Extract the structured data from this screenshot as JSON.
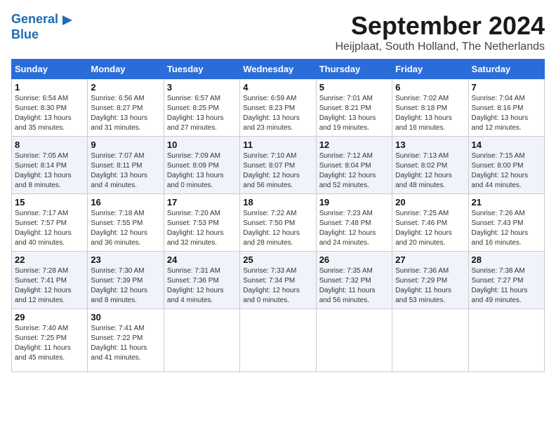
{
  "header": {
    "logo_line1": "General",
    "logo_line2": "Blue",
    "month_title": "September 2024",
    "location": "Heijplaat, South Holland, The Netherlands"
  },
  "weekdays": [
    "Sunday",
    "Monday",
    "Tuesday",
    "Wednesday",
    "Thursday",
    "Friday",
    "Saturday"
  ],
  "weeks": [
    [
      {
        "day": "1",
        "info": "Sunrise: 6:54 AM\nSunset: 8:30 PM\nDaylight: 13 hours\nand 35 minutes."
      },
      {
        "day": "2",
        "info": "Sunrise: 6:56 AM\nSunset: 8:27 PM\nDaylight: 13 hours\nand 31 minutes."
      },
      {
        "day": "3",
        "info": "Sunrise: 6:57 AM\nSunset: 8:25 PM\nDaylight: 13 hours\nand 27 minutes."
      },
      {
        "day": "4",
        "info": "Sunrise: 6:59 AM\nSunset: 8:23 PM\nDaylight: 13 hours\nand 23 minutes."
      },
      {
        "day": "5",
        "info": "Sunrise: 7:01 AM\nSunset: 8:21 PM\nDaylight: 13 hours\nand 19 minutes."
      },
      {
        "day": "6",
        "info": "Sunrise: 7:02 AM\nSunset: 8:18 PM\nDaylight: 13 hours\nand 16 minutes."
      },
      {
        "day": "7",
        "info": "Sunrise: 7:04 AM\nSunset: 8:16 PM\nDaylight: 13 hours\nand 12 minutes."
      }
    ],
    [
      {
        "day": "8",
        "info": "Sunrise: 7:05 AM\nSunset: 8:14 PM\nDaylight: 13 hours\nand 8 minutes."
      },
      {
        "day": "9",
        "info": "Sunrise: 7:07 AM\nSunset: 8:11 PM\nDaylight: 13 hours\nand 4 minutes."
      },
      {
        "day": "10",
        "info": "Sunrise: 7:09 AM\nSunset: 8:09 PM\nDaylight: 13 hours\nand 0 minutes."
      },
      {
        "day": "11",
        "info": "Sunrise: 7:10 AM\nSunset: 8:07 PM\nDaylight: 12 hours\nand 56 minutes."
      },
      {
        "day": "12",
        "info": "Sunrise: 7:12 AM\nSunset: 8:04 PM\nDaylight: 12 hours\nand 52 minutes."
      },
      {
        "day": "13",
        "info": "Sunrise: 7:13 AM\nSunset: 8:02 PM\nDaylight: 12 hours\nand 48 minutes."
      },
      {
        "day": "14",
        "info": "Sunrise: 7:15 AM\nSunset: 8:00 PM\nDaylight: 12 hours\nand 44 minutes."
      }
    ],
    [
      {
        "day": "15",
        "info": "Sunrise: 7:17 AM\nSunset: 7:57 PM\nDaylight: 12 hours\nand 40 minutes."
      },
      {
        "day": "16",
        "info": "Sunrise: 7:18 AM\nSunset: 7:55 PM\nDaylight: 12 hours\nand 36 minutes."
      },
      {
        "day": "17",
        "info": "Sunrise: 7:20 AM\nSunset: 7:53 PM\nDaylight: 12 hours\nand 32 minutes."
      },
      {
        "day": "18",
        "info": "Sunrise: 7:22 AM\nSunset: 7:50 PM\nDaylight: 12 hours\nand 28 minutes."
      },
      {
        "day": "19",
        "info": "Sunrise: 7:23 AM\nSunset: 7:48 PM\nDaylight: 12 hours\nand 24 minutes."
      },
      {
        "day": "20",
        "info": "Sunrise: 7:25 AM\nSunset: 7:46 PM\nDaylight: 12 hours\nand 20 minutes."
      },
      {
        "day": "21",
        "info": "Sunrise: 7:26 AM\nSunset: 7:43 PM\nDaylight: 12 hours\nand 16 minutes."
      }
    ],
    [
      {
        "day": "22",
        "info": "Sunrise: 7:28 AM\nSunset: 7:41 PM\nDaylight: 12 hours\nand 12 minutes."
      },
      {
        "day": "23",
        "info": "Sunrise: 7:30 AM\nSunset: 7:39 PM\nDaylight: 12 hours\nand 8 minutes."
      },
      {
        "day": "24",
        "info": "Sunrise: 7:31 AM\nSunset: 7:36 PM\nDaylight: 12 hours\nand 4 minutes."
      },
      {
        "day": "25",
        "info": "Sunrise: 7:33 AM\nSunset: 7:34 PM\nDaylight: 12 hours\nand 0 minutes."
      },
      {
        "day": "26",
        "info": "Sunrise: 7:35 AM\nSunset: 7:32 PM\nDaylight: 11 hours\nand 56 minutes."
      },
      {
        "day": "27",
        "info": "Sunrise: 7:36 AM\nSunset: 7:29 PM\nDaylight: 11 hours\nand 53 minutes."
      },
      {
        "day": "28",
        "info": "Sunrise: 7:38 AM\nSunset: 7:27 PM\nDaylight: 11 hours\nand 49 minutes."
      }
    ],
    [
      {
        "day": "29",
        "info": "Sunrise: 7:40 AM\nSunset: 7:25 PM\nDaylight: 11 hours\nand 45 minutes."
      },
      {
        "day": "30",
        "info": "Sunrise: 7:41 AM\nSunset: 7:22 PM\nDaylight: 11 hours\nand 41 minutes."
      },
      {
        "day": "",
        "info": ""
      },
      {
        "day": "",
        "info": ""
      },
      {
        "day": "",
        "info": ""
      },
      {
        "day": "",
        "info": ""
      },
      {
        "day": "",
        "info": ""
      }
    ]
  ]
}
